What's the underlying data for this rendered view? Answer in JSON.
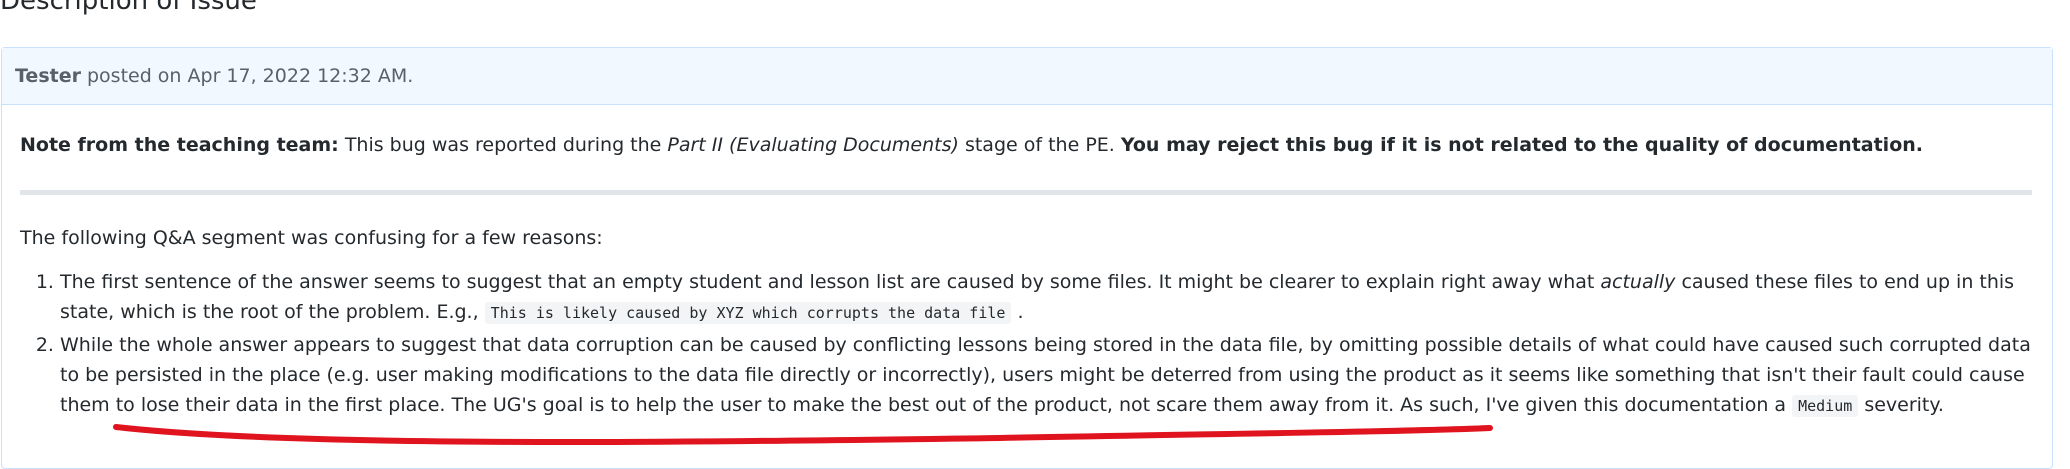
{
  "section": {
    "title": "Description of Issue"
  },
  "comment": {
    "author": "Tester",
    "posted_text": "posted on Apr 17, 2022 12:32 AM."
  },
  "note": {
    "label": "Note from the teaching team:",
    "text_1": " This bug was reported during the ",
    "stage": "Part II (Evaluating Documents)",
    "text_2": " stage of the PE. ",
    "bold_text": "You may reject this bug if it is not related to the quality of documentation."
  },
  "body": {
    "intro": "The following Q&A segment was confusing for a few reasons:",
    "items": [
      {
        "text_1": "The first sentence of the answer seems to suggest that an empty student and lesson list are caused by some files. It might be clearer to explain right away what ",
        "emph": "actually",
        "text_2": " caused these files to end up in this state, which is the root of the problem. E.g., ",
        "code": "This is likely caused by XYZ which corrupts the data file",
        "text_3": " ."
      },
      {
        "text_1": "While the whole answer appears to suggest that data corruption can be caused by conflicting lessons being stored in the data file, by omitting possible details of what could have caused such corrupted data to be persisted in the place (e.g. user making modifications to the data file directly or incorrectly), users might be deterred from using the product as it seems like something that isn't their fault could cause them to lose their data in the first place. The UG's goal is to help the user to make the best out of the product, not scare them away from it. As such, I've given this documentation a ",
        "code": "Medium",
        "text_2": " severity."
      }
    ]
  },
  "annotation": {
    "color": "#e0141e"
  }
}
